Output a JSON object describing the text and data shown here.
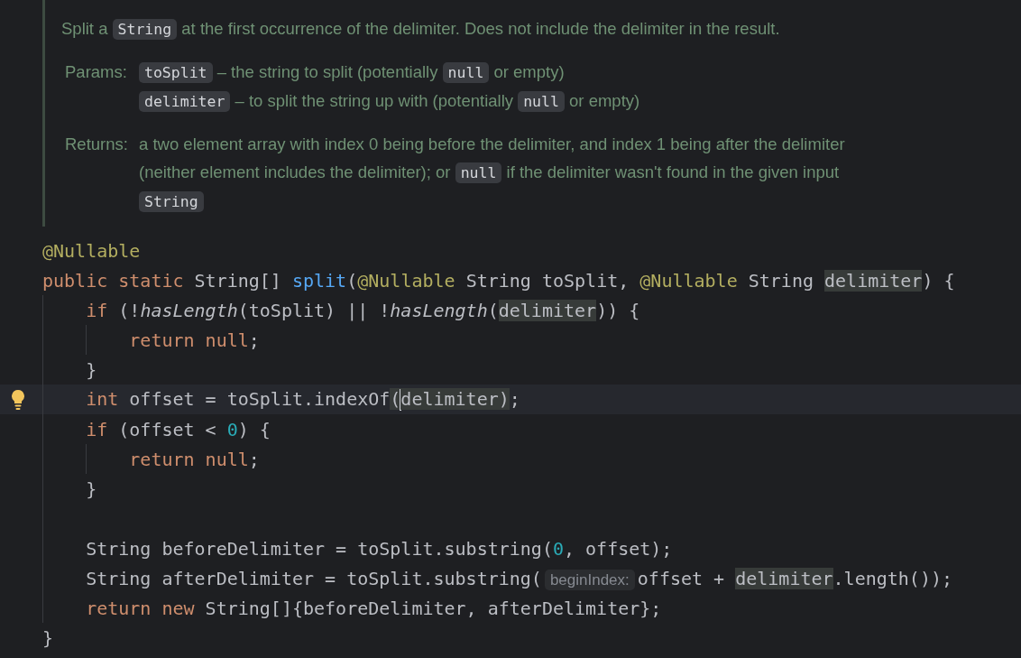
{
  "doc": {
    "summary": [
      {
        "kind": "text",
        "text": "Split a "
      },
      {
        "kind": "code",
        "text": "String"
      },
      {
        "kind": "text",
        "text": " at the first occurrence of the delimiter. Does not include the delimiter in the result."
      }
    ],
    "sections": [
      {
        "label": "Params:",
        "items": [
          [
            {
              "kind": "code",
              "text": "toSplit"
            },
            {
              "kind": "text",
              "text": " – the string to split (potentially "
            },
            {
              "kind": "code",
              "text": "null"
            },
            {
              "kind": "text",
              "text": " or empty)"
            }
          ],
          [
            {
              "kind": "code",
              "text": "delimiter"
            },
            {
              "kind": "text",
              "text": " – to split the string up with (potentially "
            },
            {
              "kind": "code",
              "text": "null"
            },
            {
              "kind": "text",
              "text": " or empty)"
            }
          ]
        ]
      },
      {
        "label": "Returns:",
        "items": [
          [
            {
              "kind": "text",
              "text": "a two element array with index 0 being before the delimiter, and index 1 being after the delimiter (neither element includes the delimiter); or "
            },
            {
              "kind": "code",
              "text": "null"
            },
            {
              "kind": "text",
              "text": " if the delimiter wasn't found in the given input "
            },
            {
              "kind": "code",
              "text": "String"
            }
          ]
        ]
      }
    ]
  },
  "code": [
    {
      "kind": "code",
      "current": false,
      "tokens": [
        {
          "kind": "annotation",
          "text": "@Nullable"
        }
      ]
    },
    {
      "kind": "code",
      "current": false,
      "tokens": [
        {
          "kind": "keyword",
          "text": "public static "
        },
        {
          "kind": "plain",
          "text": "String[] "
        },
        {
          "kind": "declaration",
          "text": "split"
        },
        {
          "kind": "plain",
          "text": "("
        },
        {
          "kind": "annotation",
          "text": "@Nullable "
        },
        {
          "kind": "plain",
          "text": "String toSplit, "
        },
        {
          "kind": "annotation",
          "text": "@Nullable "
        },
        {
          "kind": "plain",
          "text": "String "
        },
        {
          "kind": "highlight",
          "text": "delimiter"
        },
        {
          "kind": "plain",
          "text": ") {"
        }
      ],
      "children": [
        {
          "kind": "code",
          "current": false,
          "tokens": [
            {
              "kind": "keyword",
              "text": "if "
            },
            {
              "kind": "plain",
              "text": "(!"
            },
            {
              "kind": "static",
              "text": "hasLength"
            },
            {
              "kind": "plain",
              "text": "(toSplit) || !"
            },
            {
              "kind": "static",
              "text": "hasLength"
            },
            {
              "kind": "plain",
              "text": "("
            },
            {
              "kind": "highlight",
              "text": "delimiter"
            },
            {
              "kind": "plain",
              "text": ")) {"
            }
          ],
          "children": [
            {
              "kind": "code",
              "current": false,
              "tokens": [
                {
                  "kind": "keyword",
                  "text": "return null"
                },
                {
                  "kind": "plain",
                  "text": ";"
                }
              ]
            }
          ]
        },
        {
          "kind": "code",
          "current": false,
          "tokens": [
            {
              "kind": "plain",
              "text": "}"
            }
          ]
        },
        {
          "kind": "code",
          "current": true,
          "tokens": [
            {
              "kind": "keyword",
              "text": "int "
            },
            {
              "kind": "plain",
              "text": "offset = toSplit.indexOf"
            },
            {
              "kind": "highlight",
              "text": "("
            },
            {
              "kind": "caret"
            },
            {
              "kind": "highlight",
              "text": "delimiter)"
            },
            {
              "kind": "plain",
              "text": ";"
            }
          ]
        },
        {
          "kind": "code",
          "current": false,
          "tokens": [
            {
              "kind": "keyword",
              "text": "if "
            },
            {
              "kind": "plain",
              "text": "(offset < "
            },
            {
              "kind": "number",
              "text": "0"
            },
            {
              "kind": "plain",
              "text": ") {"
            }
          ],
          "children": [
            {
              "kind": "code",
              "current": false,
              "tokens": [
                {
                  "kind": "keyword",
                  "text": "return null"
                },
                {
                  "kind": "plain",
                  "text": ";"
                }
              ]
            }
          ]
        },
        {
          "kind": "code",
          "current": false,
          "tokens": [
            {
              "kind": "plain",
              "text": "}"
            }
          ]
        },
        {
          "kind": "blank"
        },
        {
          "kind": "code",
          "current": false,
          "tokens": [
            {
              "kind": "plain",
              "text": "String beforeDelimiter = toSplit.substring("
            },
            {
              "kind": "number",
              "text": "0"
            },
            {
              "kind": "plain",
              "text": ", offset);"
            }
          ]
        },
        {
          "kind": "code",
          "current": false,
          "tokens": [
            {
              "kind": "plain",
              "text": "String afterDelimiter = toSplit.substring("
            },
            {
              "kind": "hint",
              "text": "beginIndex:"
            },
            {
              "kind": "plain",
              "text": "offset + "
            },
            {
              "kind": "highlight",
              "text": "delimiter"
            },
            {
              "kind": "plain",
              "text": ".length());"
            }
          ]
        },
        {
          "kind": "code",
          "current": false,
          "tokens": [
            {
              "kind": "keyword",
              "text": "return new "
            },
            {
              "kind": "plain",
              "text": "String[]{beforeDelimiter, afterDelimiter};"
            }
          ]
        }
      ]
    },
    {
      "kind": "code",
      "current": false,
      "tokens": [
        {
          "kind": "plain",
          "text": "}"
        }
      ]
    }
  ]
}
